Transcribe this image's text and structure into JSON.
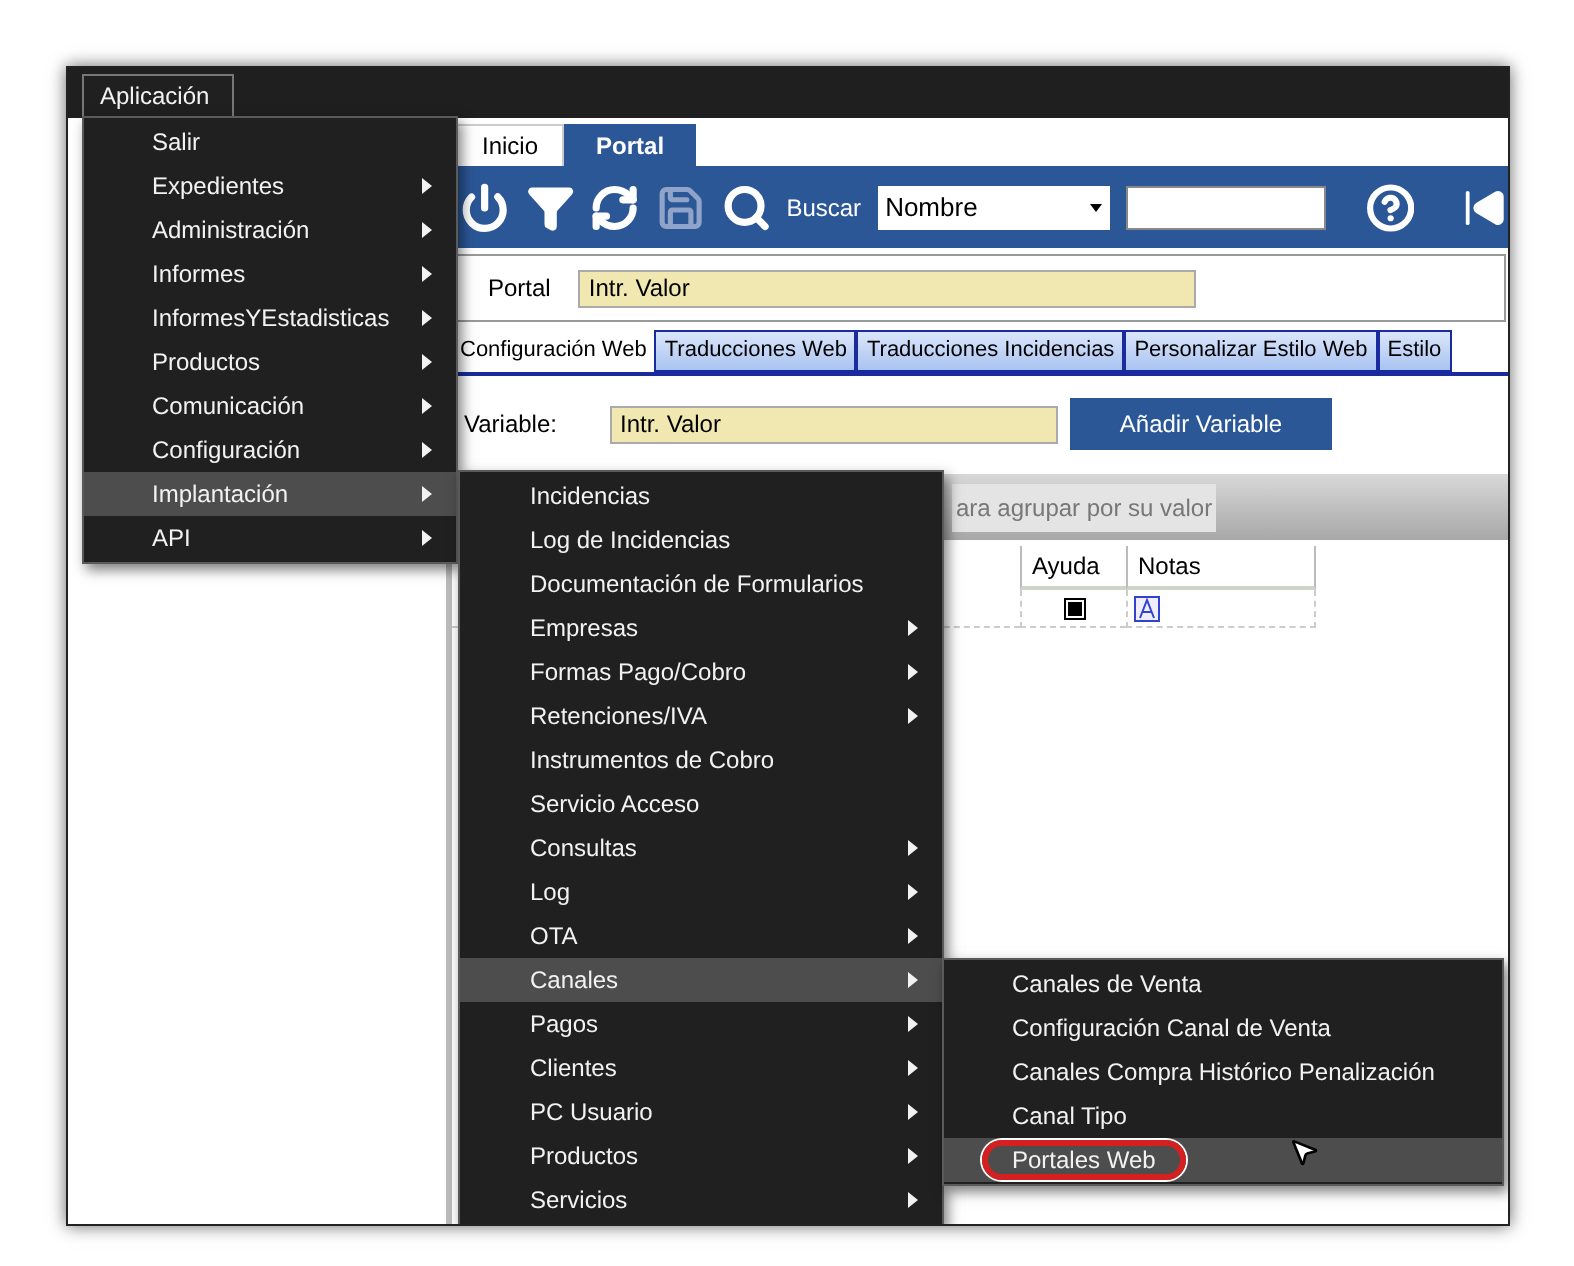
{
  "menu_bar": {
    "title": "Aplicación"
  },
  "tabs": [
    {
      "label": "Inicio",
      "selected": false
    },
    {
      "label": "Portal",
      "selected": true
    }
  ],
  "toolbar": {
    "search_label": "Buscar",
    "search_field": {
      "value": "Nombre"
    },
    "save_disabled": true
  },
  "portal_row": {
    "label": "Portal",
    "value": "Intr. Valor"
  },
  "subtabs": [
    {
      "label": "Configuración Web",
      "selected": true
    },
    {
      "label": "Traducciones Web",
      "selected": false
    },
    {
      "label": "Traducciones Incidencias",
      "selected": false
    },
    {
      "label": "Personalizar Estilo Web",
      "selected": false
    },
    {
      "label": "Estilo",
      "selected": false
    }
  ],
  "variable_row": {
    "label": "Variable:",
    "value": "Intr. Valor",
    "button": "Añadir Variable"
  },
  "group_panel": {
    "text": "ara agrupar por su valor"
  },
  "grid": {
    "columns": [
      "Ayuda",
      "Notas"
    ],
    "rows": [
      {
        "ayuda_checked": true
      }
    ]
  },
  "app_menu": {
    "items": [
      {
        "label": "Salir",
        "submenu": false,
        "selected": false
      },
      {
        "label": "Expedientes",
        "submenu": true,
        "selected": false
      },
      {
        "label": "Administración",
        "submenu": true,
        "selected": false
      },
      {
        "label": "Informes",
        "submenu": true,
        "selected": false
      },
      {
        "label": "InformesYEstadisticas",
        "submenu": true,
        "selected": false
      },
      {
        "label": "Productos",
        "submenu": true,
        "selected": false
      },
      {
        "label": "Comunicación",
        "submenu": true,
        "selected": false
      },
      {
        "label": "Configuración",
        "submenu": true,
        "selected": false
      },
      {
        "label": "Implantación",
        "submenu": true,
        "selected": true
      },
      {
        "label": "API",
        "submenu": true,
        "selected": false
      }
    ]
  },
  "implantacion_menu": {
    "items": [
      {
        "label": "Incidencias",
        "submenu": false,
        "selected": false
      },
      {
        "label": "Log de Incidencias",
        "submenu": false,
        "selected": false
      },
      {
        "label": "Documentación de Formularios",
        "submenu": false,
        "selected": false
      },
      {
        "label": "Empresas",
        "submenu": true,
        "selected": false
      },
      {
        "label": "Formas Pago/Cobro",
        "submenu": true,
        "selected": false
      },
      {
        "label": "Retenciones/IVA",
        "submenu": true,
        "selected": false
      },
      {
        "label": "Instrumentos de Cobro",
        "submenu": false,
        "selected": false
      },
      {
        "label": "Servicio Acceso",
        "submenu": false,
        "selected": false
      },
      {
        "label": "Consultas",
        "submenu": true,
        "selected": false
      },
      {
        "label": "Log",
        "submenu": true,
        "selected": false
      },
      {
        "label": "OTA",
        "submenu": true,
        "selected": false
      },
      {
        "label": "Canales",
        "submenu": true,
        "selected": true
      },
      {
        "label": "Pagos",
        "submenu": true,
        "selected": false
      },
      {
        "label": "Clientes",
        "submenu": true,
        "selected": false
      },
      {
        "label": "PC Usuario",
        "submenu": true,
        "selected": false
      },
      {
        "label": "Productos",
        "submenu": true,
        "selected": false
      },
      {
        "label": "Servicios",
        "submenu": true,
        "selected": false
      }
    ]
  },
  "canales_menu": {
    "items": [
      {
        "label": "Canales de Venta",
        "submenu": false,
        "selected": false,
        "annotated": false
      },
      {
        "label": "Configuración Canal de Venta",
        "submenu": false,
        "selected": false,
        "annotated": false
      },
      {
        "label": "Canales Compra Histórico Penalización",
        "submenu": false,
        "selected": false,
        "annotated": false
      },
      {
        "label": "Canal Tipo",
        "submenu": false,
        "selected": false,
        "annotated": false
      },
      {
        "label": "Portales Web",
        "submenu": false,
        "selected": true,
        "annotated": true
      }
    ]
  }
}
